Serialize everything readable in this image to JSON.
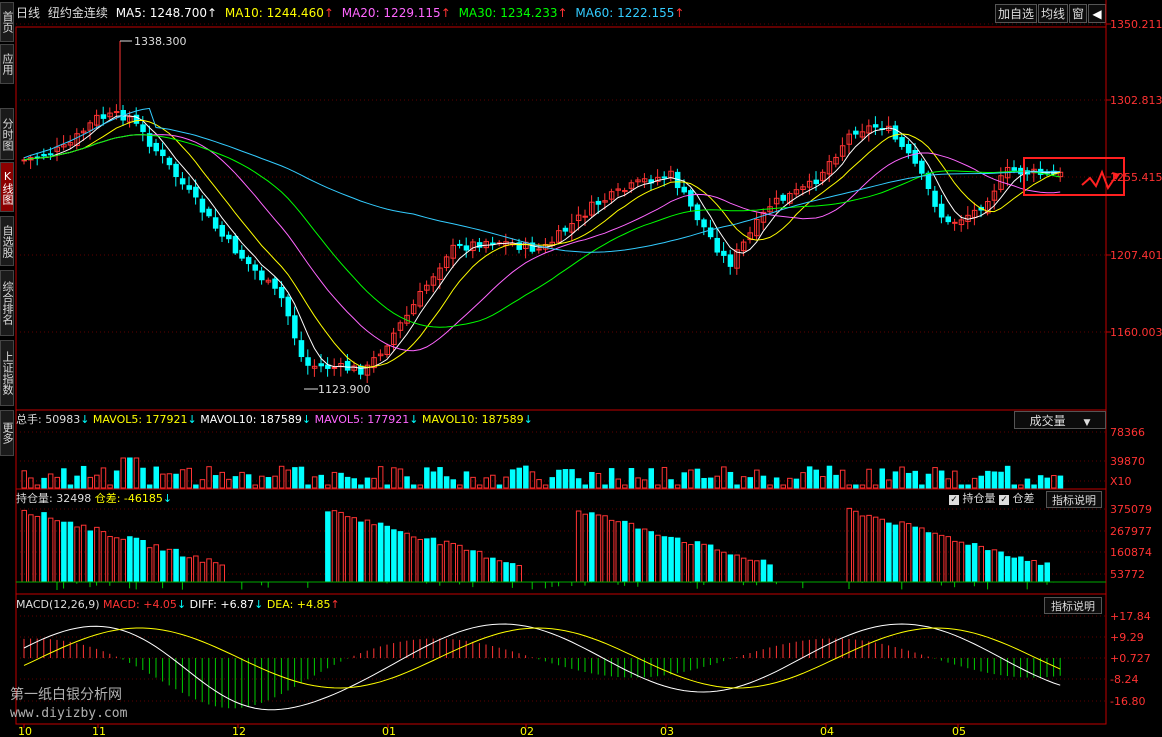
{
  "sidebar": {
    "tabs": [
      {
        "label": "首页",
        "active": false
      },
      {
        "label": "应用",
        "active": false
      },
      {
        "label": "分时图",
        "active": false
      },
      {
        "label": "K线图",
        "active": true
      },
      {
        "label": "自选股",
        "active": false
      },
      {
        "label": "综合排名",
        "active": false
      },
      {
        "label": "上证指数",
        "active": false
      },
      {
        "label": "更多",
        "active": false
      }
    ]
  },
  "header": {
    "period": "日线",
    "instrument": "纽约金连续",
    "ma5": "MA5: 1248.700",
    "ma10": "MA10: 1244.460",
    "ma20": "MA20: 1229.115",
    "ma30": "MA30: 1234.233",
    "ma60": "MA60: 1222.155",
    "arrow_up": "↑",
    "btn_add": "加自选",
    "btn_avg": "均线",
    "btn_window": "窗",
    "btn_back": "◀"
  },
  "colors": {
    "ma5": "#ffffff",
    "ma10": "#ffff00",
    "ma20": "#ff66ff",
    "ma30": "#00ff00",
    "ma60": "#33ccff",
    "up": "#ff3333",
    "down": "#00ffff",
    "axis": "#c00000",
    "grid": "#600000"
  },
  "price_panel": {
    "ticks": [
      "1350.211",
      "1302.813",
      "1255.415",
      "1207.401",
      "1160.003"
    ],
    "high_label": "1338.300",
    "low_label": "1123.900"
  },
  "volume_panel": {
    "total": "总手: 50983",
    "mavol5_a": "MAVOL5: 177921",
    "mavol10_a": "MAVOL10: 187589",
    "mavol5_b": "MAVOL5: 177921",
    "mavol10_b": "MAVOL10: 187589",
    "arrow_down": "↓",
    "dropdown": "成交量",
    "ticks": [
      "78366",
      "39870",
      "X10"
    ]
  },
  "oi_panel": {
    "oi": "持仓量: 32498",
    "diff": "仓差: -46185",
    "arrow_down": "↓",
    "check_oi": "持仓量",
    "check_diff": "仓差",
    "btn_help": "指标说明",
    "ticks": [
      "375079",
      "267977",
      "160874",
      "53772"
    ]
  },
  "macd_panel": {
    "name": "MACD(12,26,9)",
    "macd": "MACD: +4.05",
    "diff": "DIFF: +6.87",
    "dea": "DEA: +4.85",
    "arrow_down": "↓",
    "arrow_up": "↑",
    "btn_help": "指标说明",
    "ticks": [
      "+17.84",
      "+9.29",
      "+0.727",
      "-8.24",
      "-16.80"
    ]
  },
  "time_axis": {
    "labels": [
      "10",
      "11",
      "12",
      "01",
      "02",
      "03",
      "04",
      "05"
    ]
  },
  "watermark": {
    "line1": "第一纸白银分析网",
    "line2": "www.diyizby.com"
  }
}
